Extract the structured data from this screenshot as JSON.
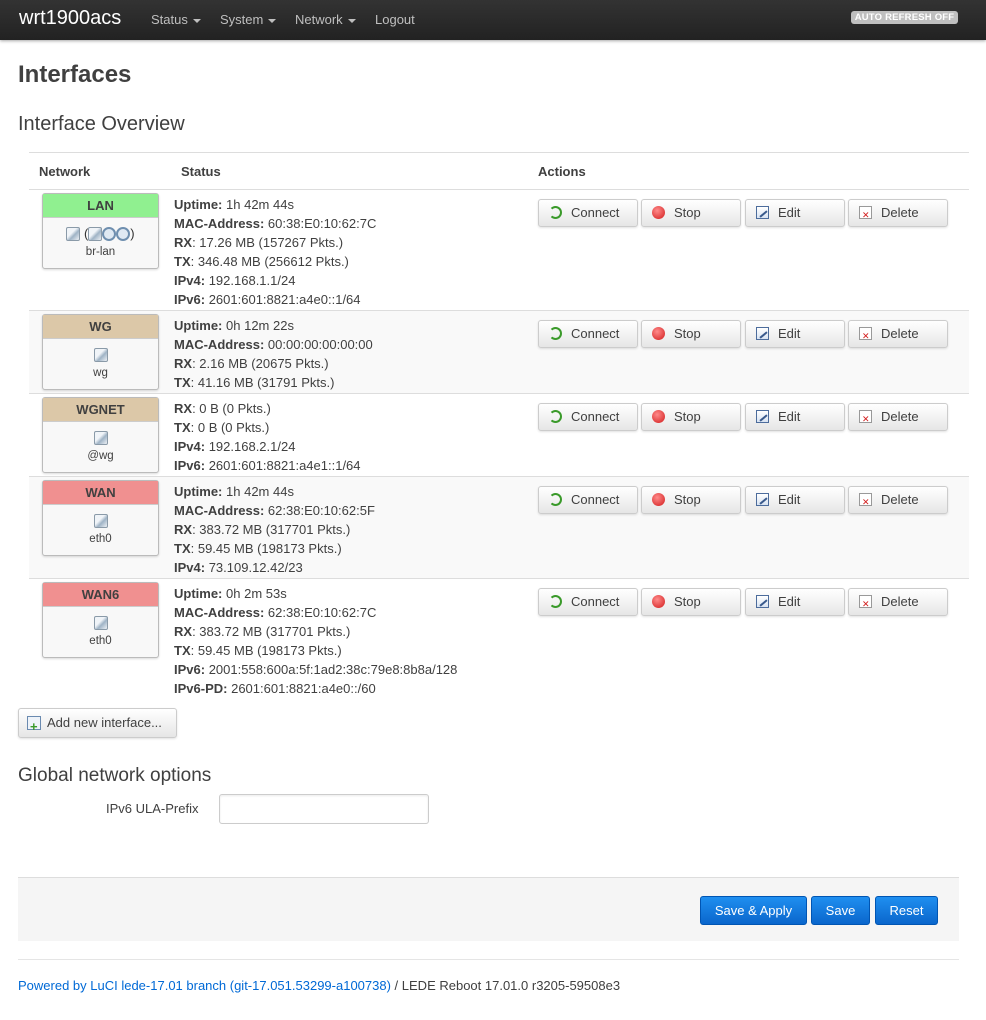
{
  "header": {
    "brand": "wrt1900acs",
    "menu": [
      {
        "label": "Status",
        "dropdown": true
      },
      {
        "label": "System",
        "dropdown": true
      },
      {
        "label": "Network",
        "dropdown": true
      },
      {
        "label": "Logout",
        "dropdown": false
      }
    ],
    "auto_refresh": "AUTO REFRESH OFF"
  },
  "page": {
    "title": "Interfaces",
    "overview_title": "Interface Overview"
  },
  "table": {
    "columns": [
      "Network",
      "Status",
      "Actions"
    ],
    "actions": {
      "connect": "Connect",
      "stop": "Stop",
      "edit": "Edit",
      "delete": "Delete"
    },
    "rows": [
      {
        "name": "LAN",
        "color": "#90f090",
        "device": "br-lan",
        "icons": "bridge+wifi",
        "status": [
          {
            "label": "Uptime:",
            "value": "1h 42m 44s"
          },
          {
            "label": "MAC-Address:",
            "value": "60:38:E0:10:62:7C"
          },
          {
            "label": "RX",
            "value": ": 17.26 MB (157267 Pkts.)"
          },
          {
            "label": "TX",
            "value": ": 346.48 MB (256612 Pkts.)"
          },
          {
            "label": "IPv4:",
            "value": "192.168.1.1/24"
          },
          {
            "label": "IPv6:",
            "value": "2601:601:8821:a4e0::1/64"
          }
        ]
      },
      {
        "name": "WG",
        "color": "#dcc8a8",
        "device": "wg",
        "icons": "ethernet",
        "status": [
          {
            "label": "Uptime:",
            "value": "0h 12m 22s"
          },
          {
            "label": "MAC-Address:",
            "value": "00:00:00:00:00:00"
          },
          {
            "label": "RX",
            "value": ": 2.16 MB (20675 Pkts.)"
          },
          {
            "label": "TX",
            "value": ": 41.16 MB (31791 Pkts.)"
          }
        ]
      },
      {
        "name": "WGNET",
        "color": "#dcc8a8",
        "device": "@wg",
        "icons": "ethernet",
        "status": [
          {
            "label": "RX",
            "value": ": 0 B (0 Pkts.)"
          },
          {
            "label": "TX",
            "value": ": 0 B (0 Pkts.)"
          },
          {
            "label": "IPv4:",
            "value": "192.168.2.1/24"
          },
          {
            "label": "IPv6:",
            "value": "2601:601:8821:a4e1::1/64"
          }
        ]
      },
      {
        "name": "WAN",
        "color": "#f09090",
        "device": "eth0",
        "icons": "ethernet",
        "status": [
          {
            "label": "Uptime:",
            "value": "1h 42m 44s"
          },
          {
            "label": "MAC-Address:",
            "value": "62:38:E0:10:62:5F"
          },
          {
            "label": "RX",
            "value": ": 383.72 MB (317701 Pkts.)"
          },
          {
            "label": "TX",
            "value": ": 59.45 MB (198173 Pkts.)"
          },
          {
            "label": "IPv4:",
            "value": "73.109.12.42/23"
          }
        ]
      },
      {
        "name": "WAN6",
        "color": "#f09090",
        "device": "eth0",
        "icons": "ethernet",
        "status": [
          {
            "label": "Uptime:",
            "value": "0h 2m 53s"
          },
          {
            "label": "MAC-Address:",
            "value": "62:38:E0:10:62:7C"
          },
          {
            "label": "RX",
            "value": ": 383.72 MB (317701 Pkts.)"
          },
          {
            "label": "TX",
            "value": ": 59.45 MB (198173 Pkts.)"
          },
          {
            "label": "IPv6:",
            "value": "2001:558:600a:5f:1ad2:38c:79e8:8b8a/128"
          },
          {
            "label": "IPv6-PD:",
            "value": "2601:601:8821:a4e0::/60"
          }
        ]
      }
    ]
  },
  "add_interface": "Add new interface...",
  "global": {
    "title": "Global network options",
    "ula_label": "IPv6 ULA-Prefix",
    "ula_value": ""
  },
  "buttons": {
    "save_apply": "Save & Apply",
    "save": "Save",
    "reset": "Reset"
  },
  "footer": {
    "powered": "Powered by LuCI lede-17.01 branch (git-17.051.53299-a100738)",
    "separator": " / ",
    "version": "LEDE Reboot 17.01.0 r3205-59508e3"
  }
}
